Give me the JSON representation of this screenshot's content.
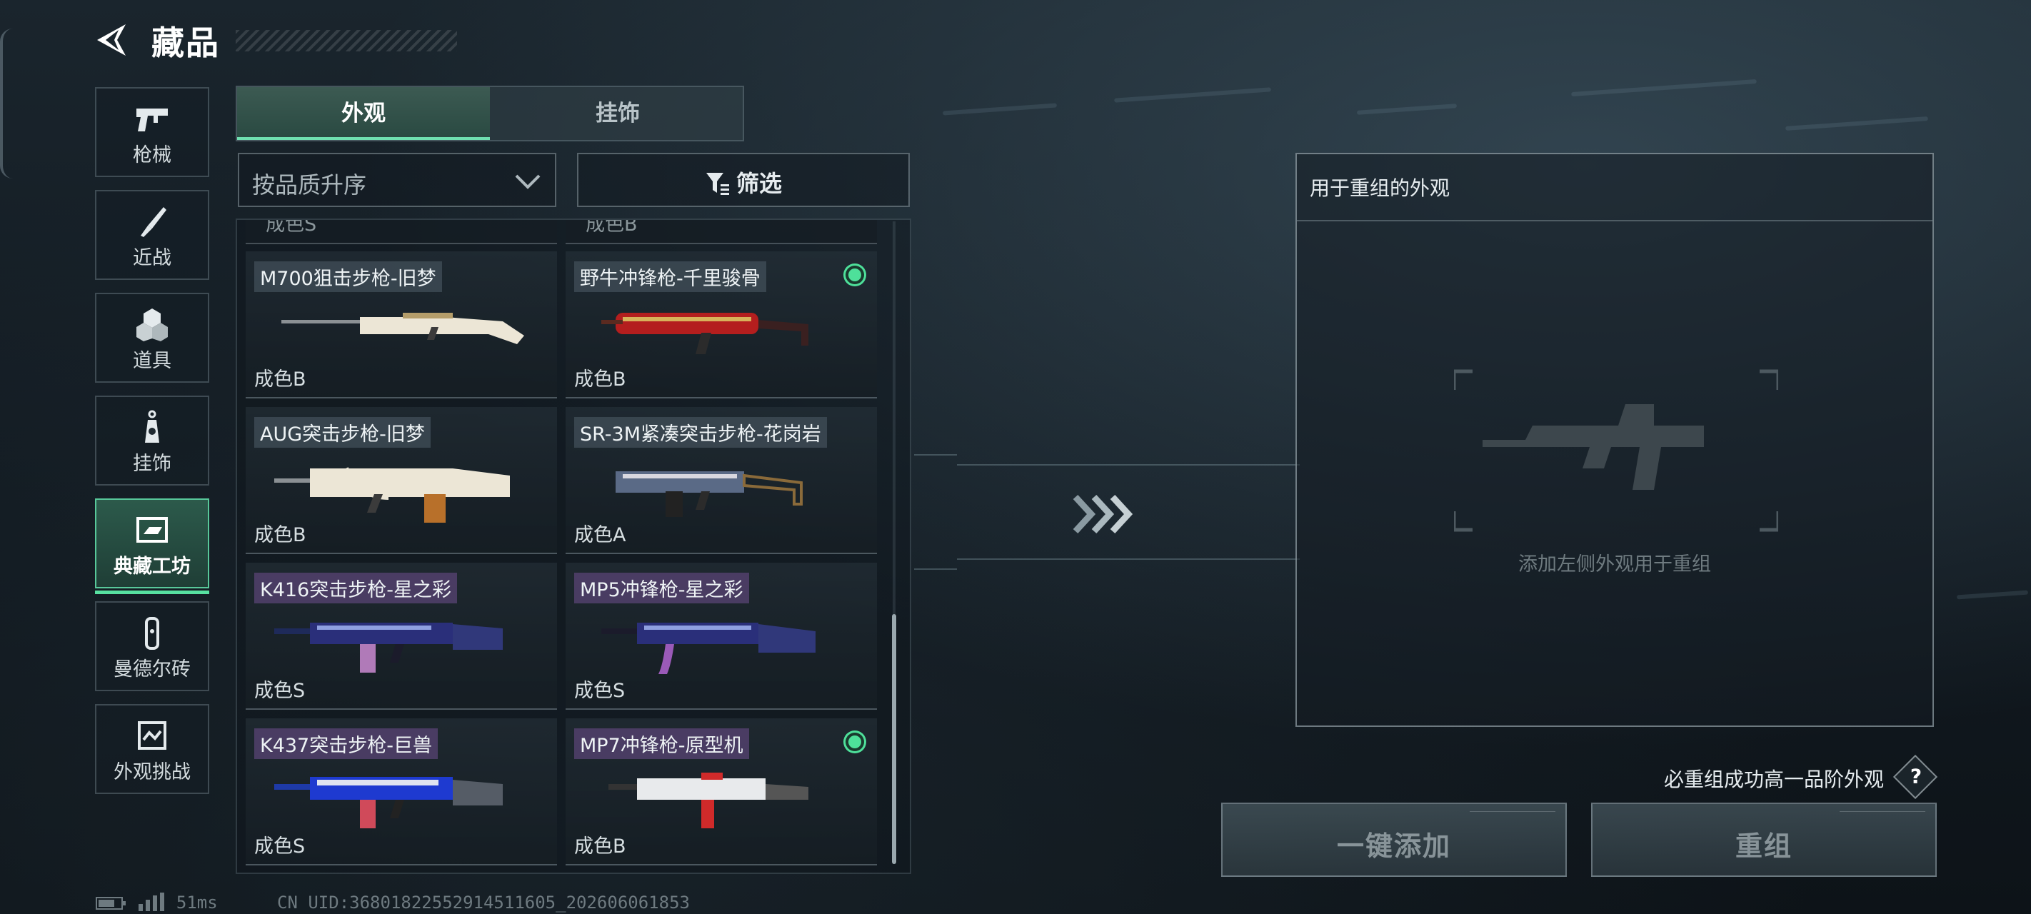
{
  "header": {
    "title": "藏品"
  },
  "sidebar": {
    "items": [
      {
        "label": "枪械",
        "icon": "pistol-icon"
      },
      {
        "label": "近战",
        "icon": "knife-icon"
      },
      {
        "label": "道具",
        "icon": "grenades-icon"
      },
      {
        "label": "挂饰",
        "icon": "charm-icon"
      },
      {
        "label": "典藏工坊",
        "icon": "workshop-icon",
        "active": true
      },
      {
        "label": "曼德尔砖",
        "icon": "brick-icon"
      },
      {
        "label": "外观挑战",
        "icon": "challenge-icon"
      }
    ]
  },
  "tabs": [
    {
      "label": "外观",
      "active": true
    },
    {
      "label": "挂饰"
    }
  ],
  "sort": {
    "label": "按品质升序"
  },
  "filter": {
    "label": "筛选"
  },
  "grid": {
    "partial_top": [
      "成色S",
      "成色B"
    ],
    "cards": [
      {
        "name": "M700狙击步枪-旧梦",
        "grade": "成色B",
        "selected": false
      },
      {
        "name": "野牛冲锋枪-千里骏骨",
        "grade": "成色B",
        "selected": true
      },
      {
        "name": "AUG突击步枪-旧梦",
        "grade": "成色B",
        "selected": false
      },
      {
        "name": "SR-3M紧凑突击步枪-花岗岩",
        "grade": "成色A",
        "selected": false
      },
      {
        "name": "K416突击步枪-星之彩",
        "grade": "成色S",
        "selected": false
      },
      {
        "name": "MP5冲锋枪-星之彩",
        "grade": "成色S",
        "selected": false
      },
      {
        "name": "K437突击步枪-巨兽",
        "grade": "成色S",
        "selected": false
      },
      {
        "name": "MP7冲锋枪-原型机",
        "grade": "成色B",
        "selected": true
      }
    ]
  },
  "recombine": {
    "title": "用于重组的外观",
    "hint": "添加左侧外观用于重组",
    "guarantee": "必重组成功高一品阶外观",
    "help": "?",
    "add_button": "一键添加",
    "recombine_button": "重组"
  },
  "status": {
    "ping": "51ms",
    "uid": "CN UID:36801822552914511605_202606061853"
  },
  "colors": {
    "accent": "#57e0a0",
    "selected_dot": "#4ee09a"
  }
}
